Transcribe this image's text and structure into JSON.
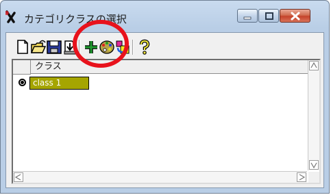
{
  "window": {
    "title": "カテゴリクラスの選択"
  },
  "toolbar": {
    "buttons": [
      {
        "icon": "new-document-icon"
      },
      {
        "icon": "open-folder-icon"
      },
      {
        "icon": "save-icon"
      },
      {
        "icon": "import-icon"
      },
      {
        "icon": "add-icon"
      },
      {
        "icon": "palette-icon"
      },
      {
        "icon": "paint-fill-icon"
      },
      {
        "icon": "help-icon"
      }
    ]
  },
  "table": {
    "header": "クラス",
    "rows": [
      {
        "label": "class 1",
        "selected": true
      }
    ]
  },
  "annotation": {
    "color": "#e8121c"
  }
}
